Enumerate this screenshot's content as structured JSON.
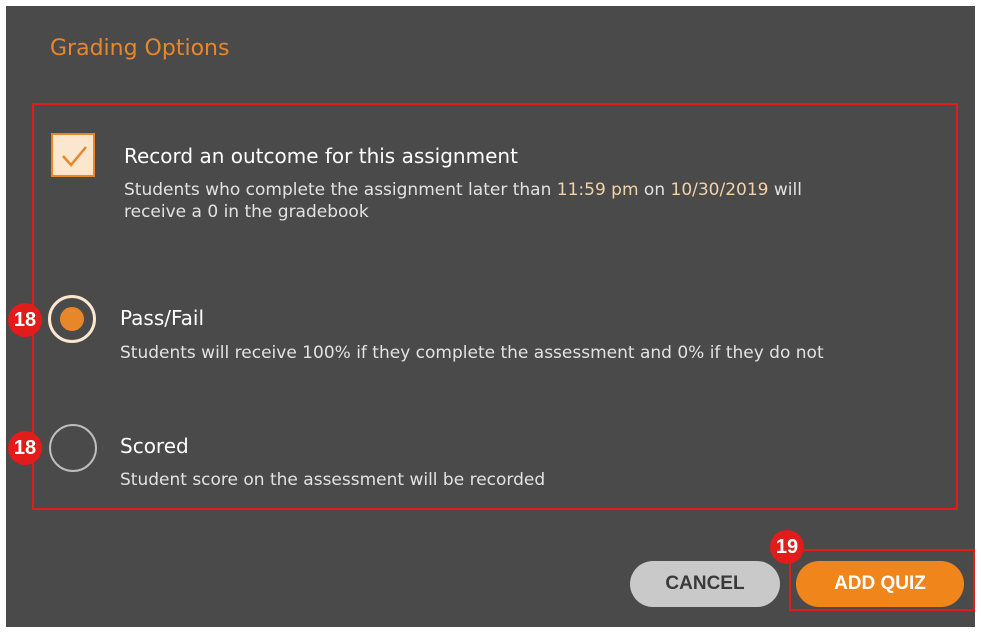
{
  "dialog": {
    "title": "Grading Options"
  },
  "record_outcome": {
    "checked": true,
    "title": "Record an outcome for this assignment",
    "desc_prefix": "Students who complete the assignment later than ",
    "time": "11:59 pm",
    "desc_mid": " on ",
    "date": "10/30/2019",
    "desc_suffix": " will",
    "desc_line2": "receive a 0 in the gradebook"
  },
  "options": [
    {
      "title": "Pass/Fail",
      "desc": "Students will receive 100% if they complete the assessment and 0% if they do not",
      "selected": true,
      "step": "18"
    },
    {
      "title": "Scored",
      "desc": "Student score on the assessment will be recorded",
      "selected": false,
      "step": "18"
    }
  ],
  "buttons": {
    "cancel": "CANCEL",
    "add_quiz": "ADD QUIZ",
    "add_quiz_step": "19"
  },
  "colors": {
    "accent": "#e8872a",
    "annotation": "#e21b1b",
    "dialog_bg": "#4a4a4a"
  }
}
